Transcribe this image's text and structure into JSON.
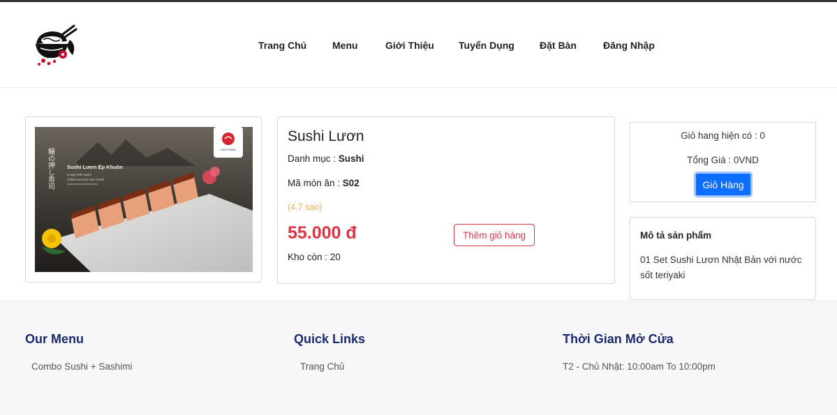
{
  "nav": {
    "items": [
      "Trang Chủ",
      "Menu",
      "Giới Thiệu",
      "Tuyển Dụng",
      "Đặt Bàn",
      "Đăng Nhập"
    ]
  },
  "product": {
    "name": "Sushi Lươn",
    "category_label": "Danh mục : ",
    "category": "Sushi",
    "code_label": "Mã món ăn : ",
    "code": "S02",
    "rating": "(4.7 sao)",
    "price": "55.000 đ",
    "add_button": "Thêm giỏ hàng",
    "stock": "Kho còn : 20",
    "image": {
      "title": "Sushi Lươn Ép Khuôn",
      "sub1": "Unagi Oshi Sushi",
      "sub2": "Grilled Sea Eel Oshi Sushi",
      "vertical_text": "鰻の押し寿司",
      "brand": "HATOYAMA"
    }
  },
  "cart": {
    "count": "Giỏ hang hiện có : 0",
    "total": "Tổng Giá : 0VND",
    "button": "Giỏ Hàng"
  },
  "description": {
    "title": "Mô tả sản phẩm",
    "text": "01 Set Sushi Lươn Nhật Bản với nước sốt teriyaki"
  },
  "footer": {
    "menu_title": "Our Menu",
    "menu_item": "Combo Sushi + Sashimi",
    "links_title": "Quick Links",
    "links_item": "Trang Chủ",
    "hours_title": "Thời Gian Mở Cửa",
    "hours_item": "T2 - Chủ Nhật: 10:00am To 10:00pm"
  },
  "colors": {
    "price": "#dc3545",
    "primary_button": "#0d6efd",
    "rating": "#f0ad4e",
    "footer_title": "#1b2b70"
  },
  "icons": {
    "logo": "ramen-bowl-logo"
  }
}
